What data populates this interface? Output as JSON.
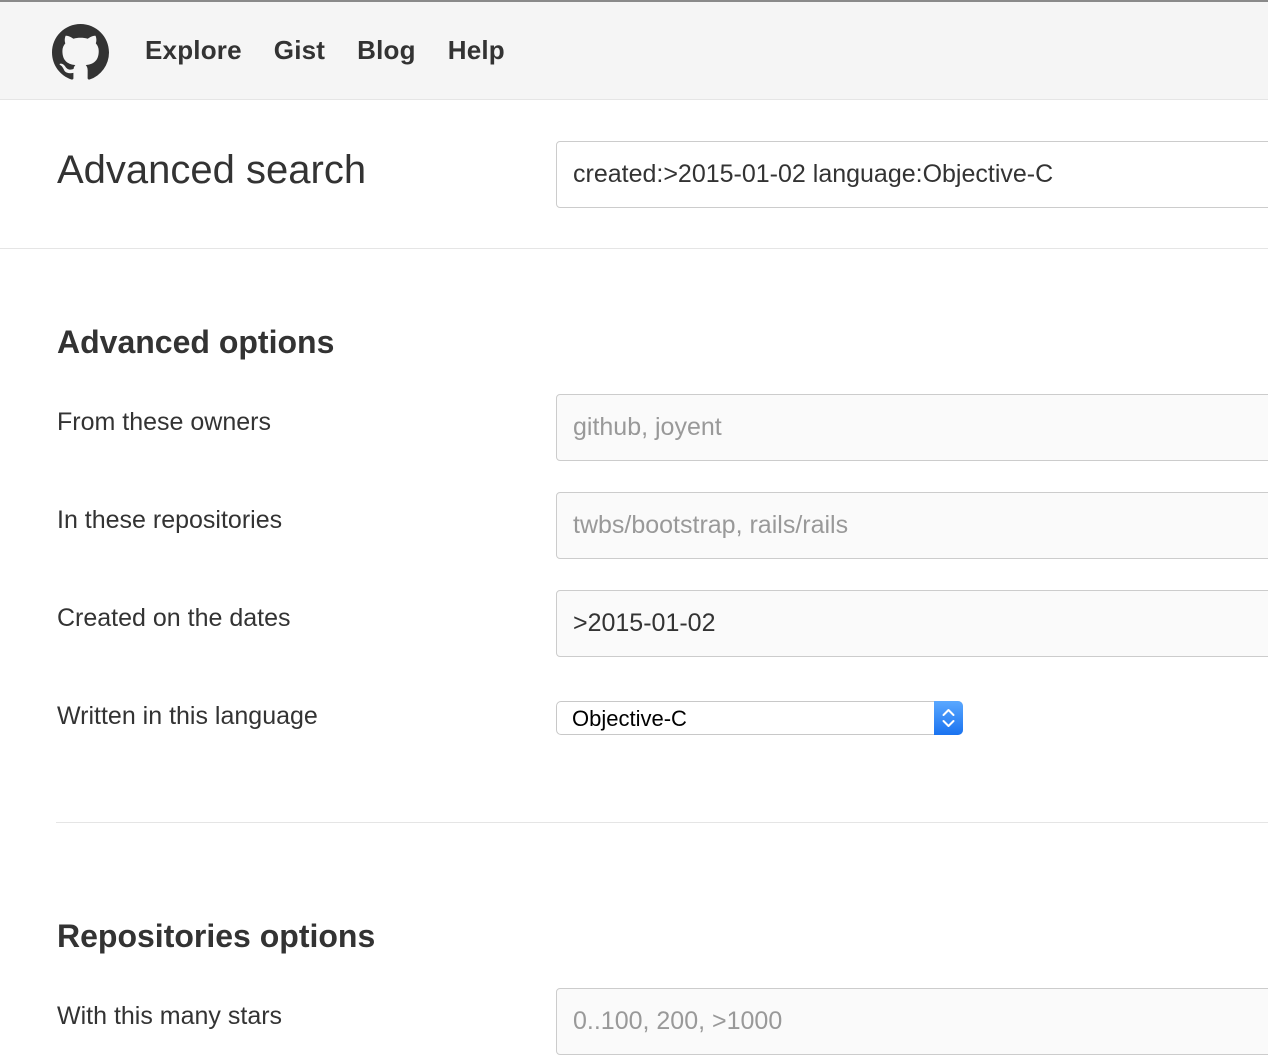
{
  "nav": {
    "items": [
      "Explore",
      "Gist",
      "Blog",
      "Help"
    ]
  },
  "search": {
    "title": "Advanced search",
    "query": "created:>2015-01-02 language:Objective-C"
  },
  "advanced": {
    "title": "Advanced options",
    "owners_label": "From these owners",
    "owners_placeholder": "github, joyent",
    "repos_label": "In these repositories",
    "repos_placeholder": "twbs/bootstrap, rails/rails",
    "dates_label": "Created on the dates",
    "dates_value": ">2015-01-02",
    "language_label": "Written in this language",
    "language_value": "Objective-C"
  },
  "repositories": {
    "title": "Repositories options",
    "stars_label": "With this many stars",
    "stars_placeholder": "0..100, 200, >1000"
  },
  "colors": {
    "header_bg": "#f5f5f5",
    "text": "#333333",
    "placeholder": "#999999",
    "select_accent": "#1a73f0"
  }
}
